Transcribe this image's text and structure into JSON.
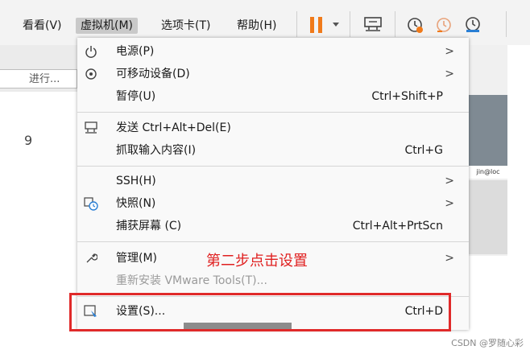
{
  "menubar": {
    "items": [
      {
        "label": "看看(V)"
      },
      {
        "label": "虚拟机(M)"
      },
      {
        "label": "选项卡(T)"
      },
      {
        "label": "帮助(H)"
      }
    ],
    "toolbar_icons": [
      "pause-icon",
      "dropdown-arrow-icon",
      "send-ctrl-alt-del-icon",
      "snapshot-take-icon",
      "snapshot-revert-icon",
      "snapshot-manager-icon"
    ]
  },
  "background": {
    "field_text": "进行...",
    "digit": "9",
    "right_panel_text": "jin@loc"
  },
  "menu": {
    "power": {
      "label": "电源(P)"
    },
    "removable": {
      "label": "可移动设备(D)"
    },
    "pause": {
      "label": "暂停(U)",
      "shortcut": "Ctrl+Shift+P"
    },
    "send_cad": {
      "label": "发送 Ctrl+Alt+Del(E)"
    },
    "grab_input": {
      "label": "抓取输入内容(I)",
      "shortcut": "Ctrl+G"
    },
    "ssh": {
      "label": "SSH(H)"
    },
    "snapshot": {
      "label": "快照(N)"
    },
    "capture_screen": {
      "label": "捕获屏幕 (C)",
      "shortcut": "Ctrl+Alt+PrtScn"
    },
    "manage": {
      "label": "管理(M)"
    },
    "reinstall_tools": {
      "label": "重新安装 VMware Tools(T)..."
    },
    "settings": {
      "label": "设置(S)...",
      "shortcut": "Ctrl+D"
    },
    "submenu_arrow": ">"
  },
  "annotation": {
    "text": "第二步点击设置",
    "color": "#e02020"
  },
  "watermark": "CSDN @罗随心彩",
  "colors": {
    "pause_orange": "#f07a1a",
    "highlight": "#e02a2a"
  }
}
